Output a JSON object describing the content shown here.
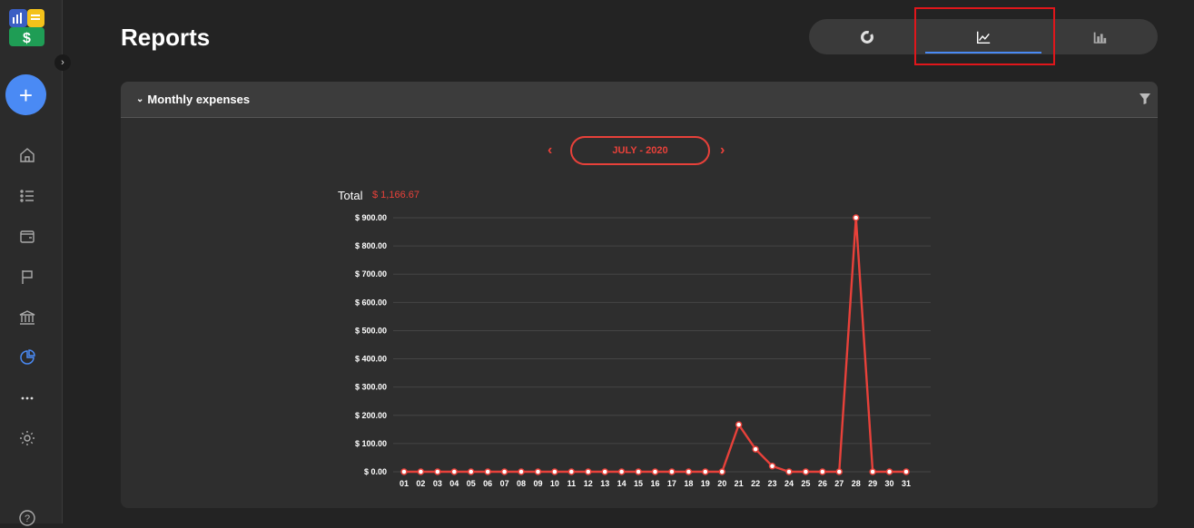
{
  "page": {
    "title": "Reports"
  },
  "sidebar": {
    "items": [
      {
        "name": "home-icon"
      },
      {
        "name": "list-icon"
      },
      {
        "name": "wallet-icon"
      },
      {
        "name": "flag-icon"
      },
      {
        "name": "bank-icon"
      },
      {
        "name": "pie-chart-icon",
        "active": true
      },
      {
        "name": "more-icon"
      },
      {
        "name": "gear-icon"
      },
      {
        "name": "help-icon"
      }
    ]
  },
  "view_switch": {
    "options": [
      "donut-chart-icon",
      "line-chart-icon",
      "bar-chart-icon"
    ],
    "active": "line-chart-icon"
  },
  "panel": {
    "title": "Monthly expenses",
    "period": "JULY - 2020",
    "total_label": "Total",
    "total_value": "$ 1,166.67"
  },
  "colors": {
    "accent": "#e8413a",
    "active": "#4a8af4"
  },
  "chart_data": {
    "type": "line",
    "x": [
      "01",
      "02",
      "03",
      "04",
      "05",
      "06",
      "07",
      "08",
      "09",
      "10",
      "11",
      "12",
      "13",
      "14",
      "15",
      "16",
      "17",
      "18",
      "19",
      "20",
      "21",
      "22",
      "23",
      "24",
      "25",
      "26",
      "27",
      "28",
      "29",
      "30",
      "31"
    ],
    "series": [
      {
        "values": [
          0,
          0,
          0,
          0,
          0,
          0,
          0,
          0,
          0,
          0,
          0,
          0,
          0,
          0,
          0,
          0,
          0,
          0,
          0,
          0,
          166.67,
          80,
          20,
          0,
          0,
          0,
          0,
          900,
          0,
          0,
          0
        ]
      }
    ],
    "yticks": [
      "$ 0.00",
      "$ 100.00",
      "$ 200.00",
      "$ 300.00",
      "$ 400.00",
      "$ 500.00",
      "$ 600.00",
      "$ 700.00",
      "$ 800.00",
      "$ 900.00"
    ],
    "ylim": [
      0,
      900
    ],
    "grid": true
  }
}
